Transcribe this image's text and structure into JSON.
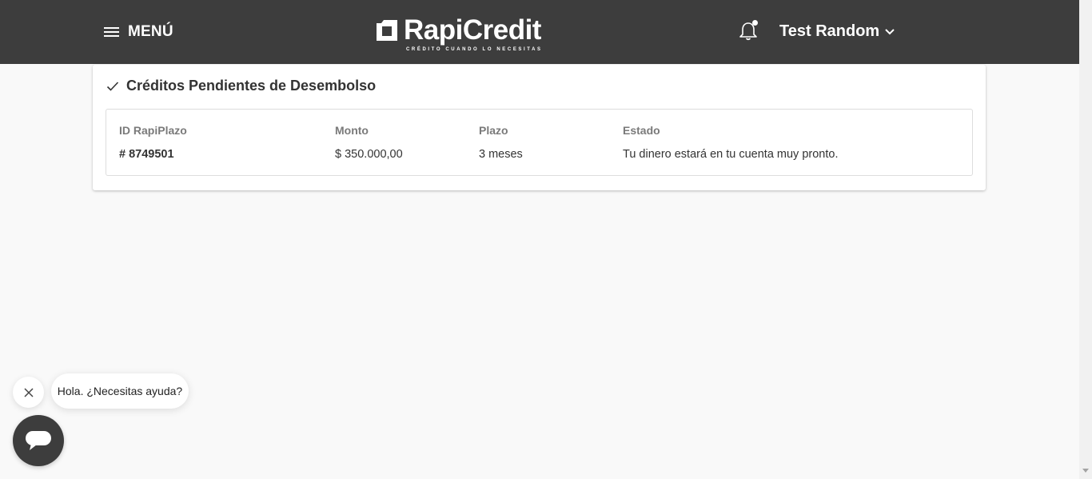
{
  "header": {
    "menu_label": "MENÚ",
    "logo_text": "RapiCredit",
    "logo_tagline": "CRÉDITO CUANDO LO NECESITAS",
    "user_name": "Test Random"
  },
  "card": {
    "title": "Créditos Pendientes de Desembolso",
    "columns": {
      "id": {
        "header": "ID RapiPlazo",
        "value": "# 8749501"
      },
      "amount": {
        "header": "Monto",
        "value": "$ 350.000,00"
      },
      "term": {
        "header": "Plazo",
        "value": "3 meses"
      },
      "status": {
        "header": "Estado",
        "value": "Tu dinero estará en tu cuenta muy pronto."
      }
    }
  },
  "chat": {
    "greeting": "Hola. ¿Necesitas ayuda?"
  },
  "colors": {
    "header_bg": "#3d3d3d",
    "page_bg": "#f9f9f9",
    "card_bg": "#ffffff",
    "header_text": "#ffffff",
    "muted_text": "#7a7a7a"
  },
  "icons": [
    "hamburger-icon",
    "logo-icon",
    "bell-icon",
    "chevron-down-icon",
    "check-icon",
    "close-icon",
    "chat-icon"
  ]
}
